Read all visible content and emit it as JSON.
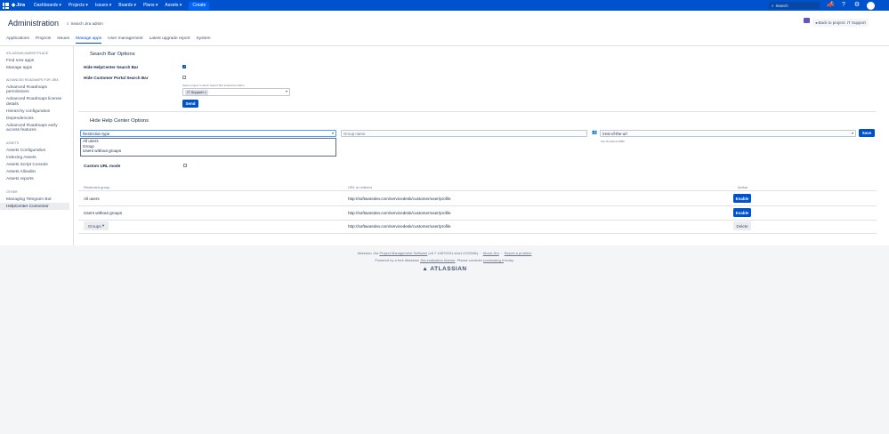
{
  "topnav": {
    "brand": "Jira",
    "menu": [
      "Dashboards",
      "Projects",
      "Issues",
      "Boards",
      "Plans",
      "Assets"
    ],
    "create": "Create",
    "search_placeholder": "Search",
    "icons": [
      "app-switcher-icon",
      "megaphone-icon",
      "help-icon",
      "gear-icon",
      "user-avatar"
    ],
    "brand_color": "#0052cc"
  },
  "header": {
    "title": "Administration",
    "search_label": "Search Jira admin",
    "back_button": "Back to project: IT Support"
  },
  "tabs": [
    {
      "label": "Applications",
      "active": false
    },
    {
      "label": "Projects",
      "active": false
    },
    {
      "label": "Issues",
      "active": false
    },
    {
      "label": "Manage apps",
      "active": true
    },
    {
      "label": "User management",
      "active": false
    },
    {
      "label": "Latest upgrade report",
      "active": false
    },
    {
      "label": "System",
      "active": false
    }
  ],
  "sidebar": {
    "sections": [
      {
        "heading": "ATLASSIAN MARKETPLACE",
        "items": [
          "Find new apps",
          "Manage apps"
        ]
      },
      {
        "heading": "ADVANCED ROADMAPS FOR JIRA",
        "items": [
          "Advanced Roadmaps permissions",
          "Advanced Roadmaps license details",
          "Hierarchy configuration",
          "Dependencies",
          "Advanced Roadmaps early access features"
        ]
      },
      {
        "heading": "ASSETS",
        "items": [
          "Assets Configuration",
          "Indexing Assets",
          "Assets Script Console",
          "Assets Allowlist",
          "Assets reports"
        ]
      },
      {
        "heading": "OTHER",
        "items": [
          "Managing Telegram Bot",
          "HelpCenter Connector"
        ]
      }
    ],
    "active_item": "HelpCenter Connector"
  },
  "search_bar_options": {
    "title": "Search Bar Options",
    "hide_helpcenter_label": "Hide HelpCenter Search Bar",
    "hide_helpcenter_checked": true,
    "hide_portal_label": "Hide Customer Portal Search Bar",
    "hide_portal_checked": false,
    "project_hint": "Select project to which Search Bar should be hidden",
    "project_tag": "IT Support",
    "send_button": "Send"
  },
  "help_center_options": {
    "title": "Hide Help Center Options",
    "restriction_placeholder": "Restriction type",
    "restriction_options": [
      "All users",
      "Group",
      "Users without groups"
    ],
    "group_placeholder": "Group name",
    "url_value": "/rest-of-the-url",
    "url_hint": "http://localhost:8080",
    "save_button": "Save",
    "custom_url_label": "Custom URL mode",
    "custom_url_checked": false
  },
  "table": {
    "headers": [
      "Restricted group",
      "URL to redirect",
      "Action"
    ],
    "rows": [
      {
        "group": "All users",
        "url": "http://softwaredev.com/servicedesk/customer/user/profile",
        "action": "Enable"
      },
      {
        "group": "Users without groups",
        "url": "http://softwaredev.com/servicedesk/customer/user/profile",
        "action": "Enable"
      },
      {
        "group": "Groups",
        "url": "http://softwaredev.com/servicedesk/customer/user/profile",
        "action": "Delete"
      }
    ]
  },
  "footer": {
    "line1_prefix": "Atlassian Jira",
    "line1_link": "Project Management Software",
    "line1_version": "(v8.7.1#870001-sha1:2222b8b)",
    "about_link": "About Jira",
    "report_link": "Report a problem",
    "line2_prefix": "Powered by a free Atlassian",
    "line2_link1": "Jira evaluation license",
    "line2_mid": ". Please consider",
    "line2_link2": "purchasing it",
    "line2_suffix": "today.",
    "logo": "ATLASSIAN"
  }
}
